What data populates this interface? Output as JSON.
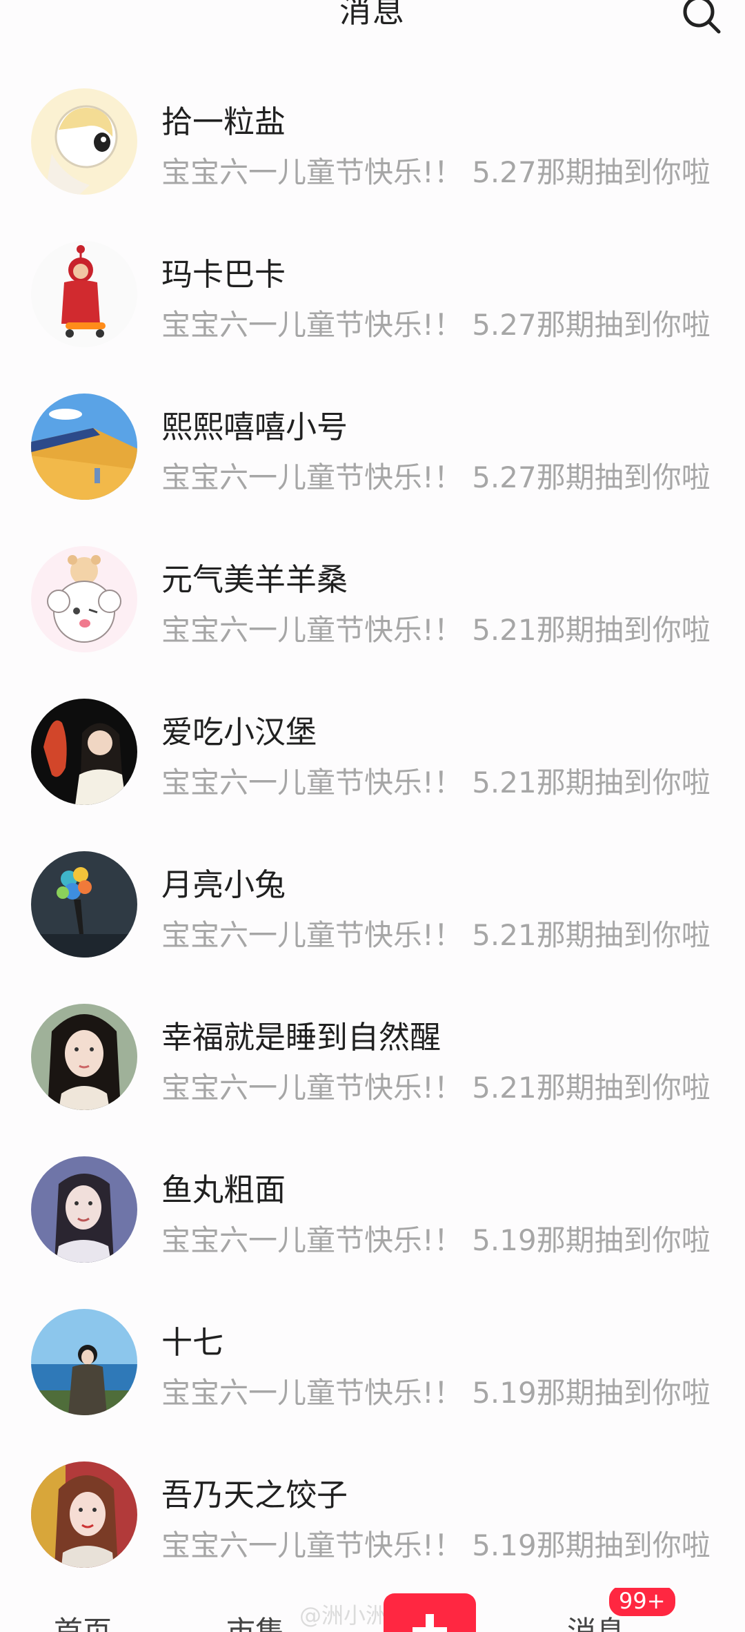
{
  "header": {
    "title": "消息",
    "search_icon": "search-icon"
  },
  "conversations": [
    {
      "name": "拾一粒盐",
      "preview": "宝宝六一儿童节快乐!！ 5.27那期抽到你啦"
    },
    {
      "name": "玛卡巴卡",
      "preview": "宝宝六一儿童节快乐!！ 5.27那期抽到你啦"
    },
    {
      "name": "熙熙嘻嘻小号",
      "preview": "宝宝六一儿童节快乐!！ 5.27那期抽到你啦"
    },
    {
      "name": "元气美羊羊桑",
      "preview": "宝宝六一儿童节快乐!！ 5.21那期抽到你啦"
    },
    {
      "name": "爱吃小汉堡",
      "preview": "宝宝六一儿童节快乐!！ 5.21那期抽到你啦"
    },
    {
      "name": "月亮小兔",
      "preview": "宝宝六一儿童节快乐!！ 5.21那期抽到你啦"
    },
    {
      "name": "幸福就是睡到自然醒",
      "preview": "宝宝六一儿童节快乐!！ 5.21那期抽到你啦"
    },
    {
      "name": "鱼丸粗面",
      "preview": "宝宝六一儿童节快乐!！ 5.19那期抽到你啦"
    },
    {
      "name": "十七",
      "preview": "宝宝六一儿童节快乐!！ 5.19那期抽到你啦"
    },
    {
      "name": "吾乃天之饺子",
      "preview": "宝宝六一儿童节快乐!！ 5.19那期抽到你啦"
    }
  ],
  "tabbar": {
    "home": "首页",
    "market": "市集",
    "messages": "消息",
    "badge": "99+",
    "accent": "#ff2741"
  },
  "watermark": "@洲小洲洲"
}
